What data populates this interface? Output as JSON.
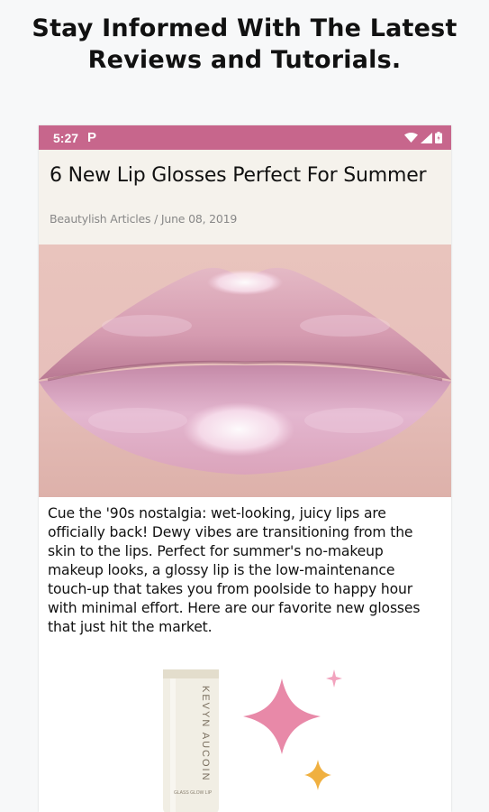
{
  "promo": {
    "line1": "Stay Informed With The Latest",
    "line2": "Reviews and Tutorials."
  },
  "status_bar": {
    "time": "5:27",
    "app_icon": "P",
    "icons": [
      "wifi-icon",
      "signal-icon",
      "battery-icon"
    ],
    "color": "#c7668c"
  },
  "article": {
    "title": "6 New Lip Glosses Perfect For Summer",
    "meta": "Beautylish Articles / June 08, 2019",
    "body": "Cue the '90s nostalgia: wet-looking, juicy lips are officially back! Dewy vibes are transitioning from the skin to the lips. Perfect for summer's no-makeup makeup looks, a glossy lip is the low-maintenance touch-up that takes you from poolside to happy hour with minimal effort. Here are our favorite new glosses that just hit the market.",
    "hero_image": "glossy-lips-photo",
    "product_image": "lip-gloss-tube-photo"
  },
  "product": {
    "brand": "KEVYN AUCOIN",
    "subtext": "GLASS GLOW LIP"
  },
  "colors": {
    "accent": "#c7668c",
    "header_bg": "#f5f2ec",
    "sparkle_pink": "#e889a8",
    "sparkle_gold": "#f0b040"
  }
}
